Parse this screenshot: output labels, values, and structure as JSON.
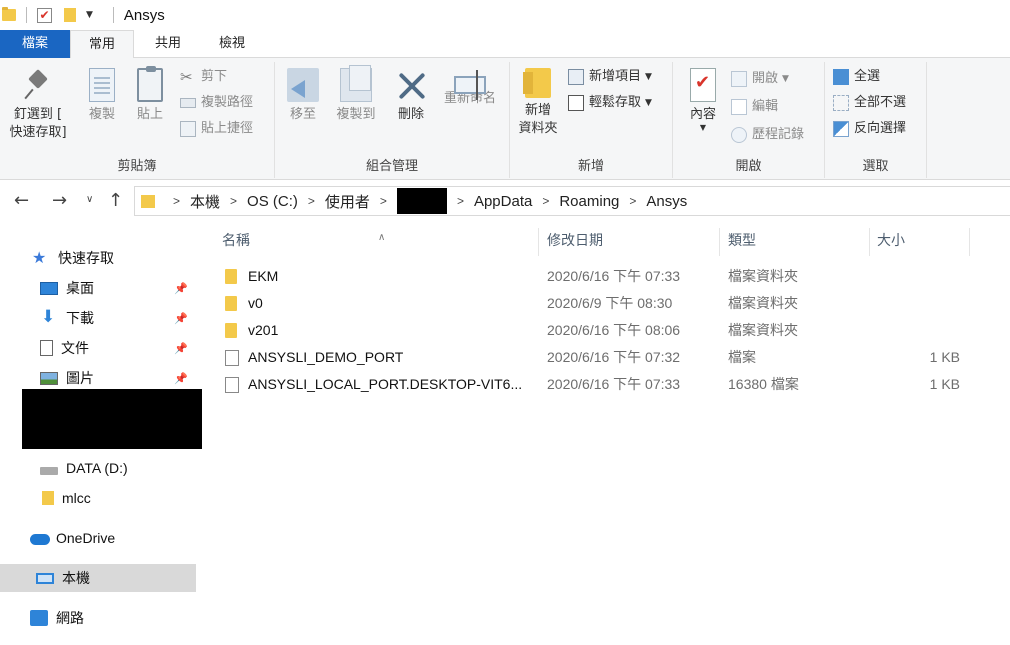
{
  "window": {
    "title": "Ansys"
  },
  "tabs": {
    "file": "檔案",
    "home": "常用",
    "share": "共用",
    "view": "檢視"
  },
  "ribbon": {
    "clipboard": {
      "label": "剪貼簿",
      "pin": "釘選到 [\n快速存取]",
      "copy": "複製",
      "paste": "貼上",
      "cut": "剪下",
      "copy_path": "複製路徑",
      "paste_shortcut": "貼上捷徑"
    },
    "organize": {
      "label": "組合管理",
      "move_to": "移至",
      "copy_to": "複製到",
      "delete": "刪除",
      "rename": "重新命名"
    },
    "new": {
      "label": "新增",
      "new_folder": "新增\n資料夾",
      "new_item": "新增項目",
      "easy_access": "輕鬆存取"
    },
    "open": {
      "label": "開啟",
      "properties": "內容",
      "open": "開啟",
      "edit": "編輯",
      "history": "歷程記錄"
    },
    "select": {
      "label": "選取",
      "select_all": "全選",
      "select_none": "全部不選",
      "invert": "反向選擇"
    }
  },
  "address": {
    "segments": [
      "本機",
      "OS (C:)",
      "使用者",
      "AppData",
      "Roaming",
      "Ansys"
    ]
  },
  "nav": {
    "quick_access": "快速存取",
    "desktop": "桌面",
    "downloads": "下載",
    "documents": "文件",
    "pictures": "圖片",
    "data_drive": "DATA (D:)",
    "mlcc": "mlcc",
    "onedrive": "OneDrive",
    "this_pc": "本機",
    "network": "網路"
  },
  "columns": {
    "name": "名稱",
    "date": "修改日期",
    "type": "類型",
    "size": "大小"
  },
  "files": [
    {
      "name": "EKM",
      "date": "2020/6/16 下午 07:33",
      "type": "檔案資料夾",
      "size": "",
      "icon": "folder-icon"
    },
    {
      "name": "v0",
      "date": "2020/6/9 下午 08:30",
      "type": "檔案資料夾",
      "size": "",
      "icon": "folder-icon"
    },
    {
      "name": "v201",
      "date": "2020/6/16 下午 08:06",
      "type": "檔案資料夾",
      "size": "",
      "icon": "folder-icon"
    },
    {
      "name": "ANSYSLI_DEMO_PORT",
      "date": "2020/6/16 下午 07:32",
      "type": "檔案",
      "size": "1 KB",
      "icon": "file-icon"
    },
    {
      "name": "ANSYSLI_LOCAL_PORT.DESKTOP-VIT6...",
      "date": "2020/6/16 下午 07:33",
      "type": "16380 檔案",
      "size": "1 KB",
      "icon": "file-icon"
    }
  ]
}
